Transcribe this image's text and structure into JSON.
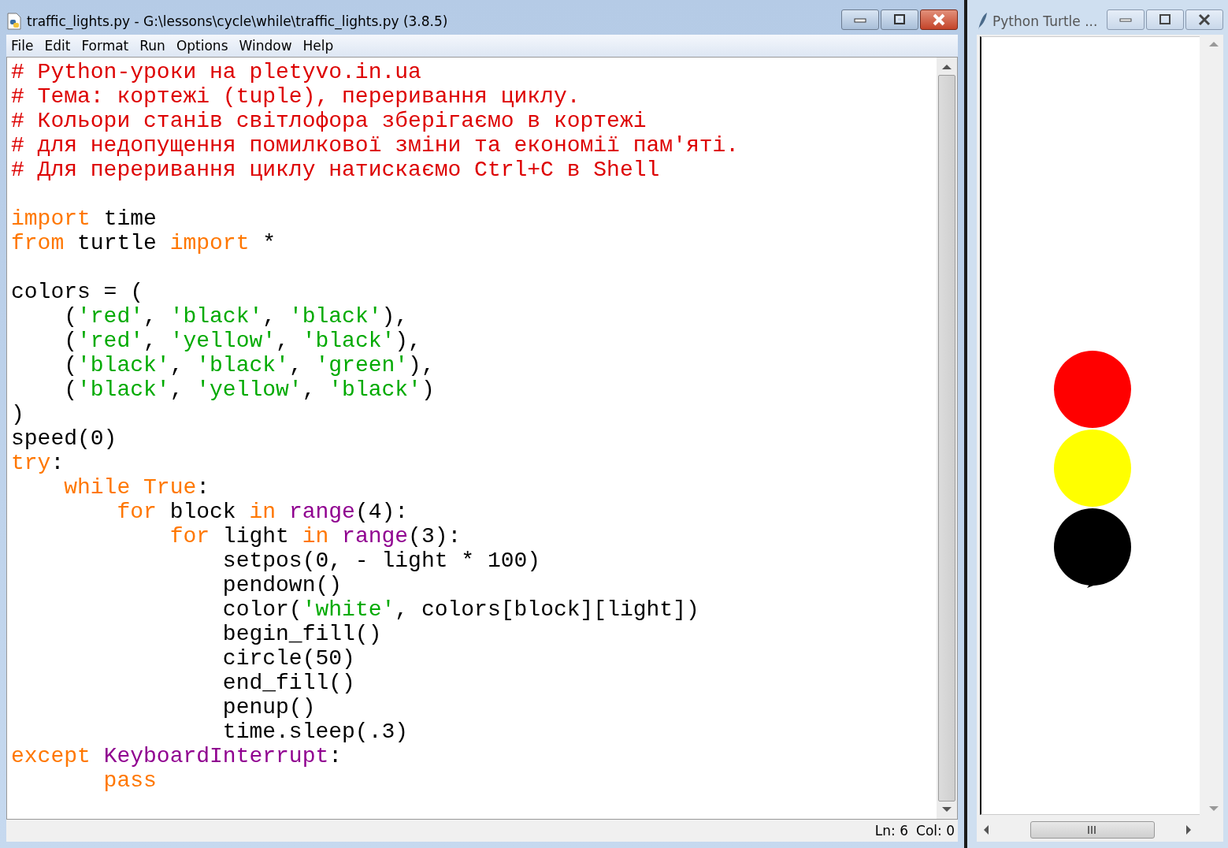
{
  "editor": {
    "title": "traffic_lights.py - G:\\lessons\\cycle\\while\\traffic_lights.py (3.8.5)",
    "menu": [
      "File",
      "Edit",
      "Format",
      "Run",
      "Options",
      "Window",
      "Help"
    ],
    "lines": [
      {
        "kind": "code",
        "tokens": [
          {
            "kind": "comment",
            "text": "# Python-уроки на pletyvo.in.ua"
          }
        ]
      },
      {
        "kind": "code",
        "tokens": [
          {
            "kind": "comment",
            "text": "# Тема: кортежі (tuple), переривання циклу."
          }
        ]
      },
      {
        "kind": "code",
        "tokens": [
          {
            "kind": "comment",
            "text": "# Кольори станів світлофора зберігаємо в кортежі"
          }
        ]
      },
      {
        "kind": "code",
        "tokens": [
          {
            "kind": "comment",
            "text": "# для недопущення помилкової зміни та економії пам'яті."
          }
        ]
      },
      {
        "kind": "code",
        "tokens": [
          {
            "kind": "comment",
            "text": "# Для переривання циклу натискаємо Ctrl+C в Shell"
          }
        ]
      },
      {
        "kind": "blank"
      },
      {
        "kind": "code",
        "tokens": [
          {
            "kind": "keyword",
            "text": "import"
          },
          {
            "kind": "plain",
            "text": " time"
          }
        ]
      },
      {
        "kind": "code",
        "tokens": [
          {
            "kind": "keyword",
            "text": "from"
          },
          {
            "kind": "plain",
            "text": " turtle "
          },
          {
            "kind": "keyword",
            "text": "import"
          },
          {
            "kind": "plain",
            "text": " *"
          }
        ]
      },
      {
        "kind": "blank"
      },
      {
        "kind": "code",
        "tokens": [
          {
            "kind": "plain",
            "text": "colors = ("
          }
        ]
      },
      {
        "kind": "code",
        "tokens": [
          {
            "kind": "plain",
            "text": "    ("
          },
          {
            "kind": "string",
            "text": "'red'"
          },
          {
            "kind": "plain",
            "text": ", "
          },
          {
            "kind": "string",
            "text": "'black'"
          },
          {
            "kind": "plain",
            "text": ", "
          },
          {
            "kind": "string",
            "text": "'black'"
          },
          {
            "kind": "plain",
            "text": "),"
          }
        ]
      },
      {
        "kind": "code",
        "tokens": [
          {
            "kind": "plain",
            "text": "    ("
          },
          {
            "kind": "string",
            "text": "'red'"
          },
          {
            "kind": "plain",
            "text": ", "
          },
          {
            "kind": "string",
            "text": "'yellow'"
          },
          {
            "kind": "plain",
            "text": ", "
          },
          {
            "kind": "string",
            "text": "'black'"
          },
          {
            "kind": "plain",
            "text": "),"
          }
        ]
      },
      {
        "kind": "code",
        "tokens": [
          {
            "kind": "plain",
            "text": "    ("
          },
          {
            "kind": "string",
            "text": "'black'"
          },
          {
            "kind": "plain",
            "text": ", "
          },
          {
            "kind": "string",
            "text": "'black'"
          },
          {
            "kind": "plain",
            "text": ", "
          },
          {
            "kind": "string",
            "text": "'green'"
          },
          {
            "kind": "plain",
            "text": "),"
          }
        ]
      },
      {
        "kind": "code",
        "tokens": [
          {
            "kind": "plain",
            "text": "    ("
          },
          {
            "kind": "string",
            "text": "'black'"
          },
          {
            "kind": "plain",
            "text": ", "
          },
          {
            "kind": "string",
            "text": "'yellow'"
          },
          {
            "kind": "plain",
            "text": ", "
          },
          {
            "kind": "string",
            "text": "'black'"
          },
          {
            "kind": "plain",
            "text": ")"
          }
        ]
      },
      {
        "kind": "code",
        "tokens": [
          {
            "kind": "plain",
            "text": ")"
          }
        ]
      },
      {
        "kind": "code",
        "tokens": [
          {
            "kind": "plain",
            "text": "speed(0)"
          }
        ]
      },
      {
        "kind": "code",
        "tokens": [
          {
            "kind": "keyword",
            "text": "try"
          },
          {
            "kind": "plain",
            "text": ":"
          }
        ]
      },
      {
        "kind": "code",
        "tokens": [
          {
            "kind": "keyword",
            "text": "    while True"
          },
          {
            "kind": "plain",
            "text": ":"
          }
        ]
      },
      {
        "kind": "code",
        "tokens": [
          {
            "kind": "keyword",
            "text": "        for"
          },
          {
            "kind": "plain",
            "text": " block "
          },
          {
            "kind": "keyword",
            "text": "in"
          },
          {
            "kind": "builtin",
            "text": " range"
          },
          {
            "kind": "plain",
            "text": "(4):"
          }
        ]
      },
      {
        "kind": "code",
        "tokens": [
          {
            "kind": "keyword",
            "text": "            for"
          },
          {
            "kind": "plain",
            "text": " light "
          },
          {
            "kind": "keyword",
            "text": "in"
          },
          {
            "kind": "builtin",
            "text": " range"
          },
          {
            "kind": "plain",
            "text": "(3):"
          }
        ]
      },
      {
        "kind": "code",
        "tokens": [
          {
            "kind": "plain",
            "text": "                setpos(0, - light * 100)"
          }
        ]
      },
      {
        "kind": "code",
        "tokens": [
          {
            "kind": "plain",
            "text": "                pendown()"
          }
        ]
      },
      {
        "kind": "code",
        "tokens": [
          {
            "kind": "plain",
            "text": "                color("
          },
          {
            "kind": "string",
            "text": "'white'"
          },
          {
            "kind": "plain",
            "text": ", colors[block][light])"
          }
        ]
      },
      {
        "kind": "code",
        "tokens": [
          {
            "kind": "plain",
            "text": "                begin_fill()"
          }
        ]
      },
      {
        "kind": "code",
        "tokens": [
          {
            "kind": "plain",
            "text": "                circle(50)"
          }
        ]
      },
      {
        "kind": "code",
        "tokens": [
          {
            "kind": "plain",
            "text": "                end_fill()"
          }
        ]
      },
      {
        "kind": "code",
        "tokens": [
          {
            "kind": "plain",
            "text": "                penup()"
          }
        ]
      },
      {
        "kind": "code",
        "tokens": [
          {
            "kind": "plain",
            "text": "                time.sleep(.3)"
          }
        ]
      },
      {
        "kind": "code",
        "tokens": [
          {
            "kind": "keyword",
            "text": "except"
          },
          {
            "kind": "builtin",
            "text": " KeyboardInterrupt"
          },
          {
            "kind": "plain",
            "text": ":"
          }
        ]
      },
      {
        "kind": "code",
        "tokens": [
          {
            "kind": "keyword",
            "text": "       pass"
          }
        ]
      }
    ],
    "status": {
      "line": "Ln: 6",
      "column": "Col: 0"
    }
  },
  "turtle": {
    "title": "Python Turtle ...",
    "circles": [
      {
        "color": "#ff0000"
      },
      {
        "color": "#ffff00"
      },
      {
        "color": "#000000"
      }
    ]
  }
}
